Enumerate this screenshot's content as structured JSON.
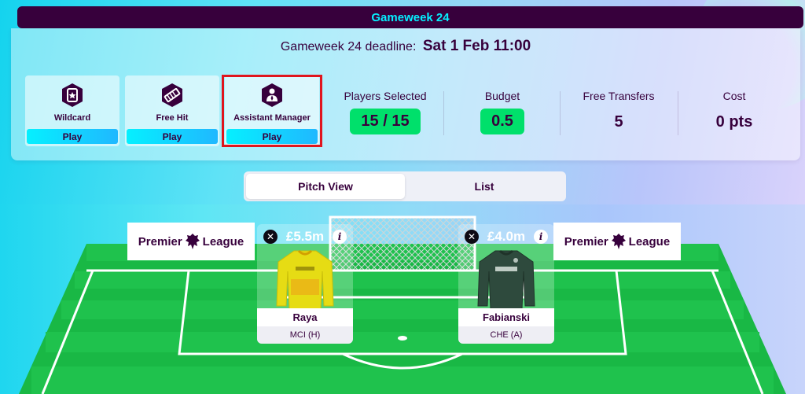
{
  "gameweek": {
    "title": "Gameweek 24",
    "deadline_label": "Gameweek 24 deadline:",
    "deadline_value": "Sat 1 Feb 11:00"
  },
  "chips": [
    {
      "name": "Wildcard",
      "button": "Play",
      "icon": "wildcard-icon"
    },
    {
      "name": "Free Hit",
      "button": "Play",
      "icon": "free-hit-icon"
    },
    {
      "name": "Assistant Manager",
      "button": "Play",
      "icon": "assistant-manager-icon"
    }
  ],
  "stats": {
    "players_selected": {
      "label": "Players Selected",
      "value": "15 / 15"
    },
    "budget": {
      "label": "Budget",
      "value": "0.5"
    },
    "free_transfers": {
      "label": "Free Transfers",
      "value": "5"
    },
    "cost": {
      "label": "Cost",
      "value": "0 pts"
    }
  },
  "view_toggle": {
    "pitch_view": "Pitch View",
    "list": "List",
    "active": "Pitch View"
  },
  "boards": {
    "left_text_1": "Premier",
    "left_text_2": "League",
    "right_text_1": "Premier",
    "right_text_2": "League"
  },
  "players": [
    {
      "name": "Raya",
      "price": "£5.5m",
      "fixture": "MCI (H)",
      "shirt_color": "#e6dc14"
    },
    {
      "name": "Fabianski",
      "price": "£4.0m",
      "fixture": "CHE (A)",
      "shirt_color": "#2e4a3d"
    }
  ],
  "colors": {
    "brand_purple": "#37003c",
    "accent_cyan": "#05f0ff",
    "accent_green": "#00e06b",
    "pitch_green": "#19b845",
    "highlight_red": "#e0151d"
  }
}
